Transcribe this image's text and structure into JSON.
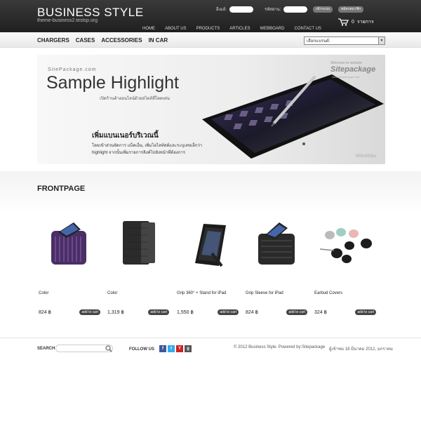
{
  "header": {
    "logo": "BUSINESS STYLE",
    "logo_sub": "theme-business2.testsp.org",
    "login": {
      "email_label": "อีเมล์:",
      "password_label": "รหัสผ่าน:",
      "login_button": "เข้าระบบ",
      "register_button": "สมัครสมาชิก"
    },
    "nav": [
      "HOME",
      "ABOUT US",
      "PRODUCTS",
      "ARTICLES",
      "WEBBOARD",
      "CONTACT US"
    ],
    "cart": {
      "count": "0",
      "label": "รายการ"
    }
  },
  "categories": [
    "CHARGERS",
    "CASES",
    "ACCESSORIES",
    "IN CAR"
  ],
  "brand_select": {
    "value": "เลือกแบรนด์:"
  },
  "banner": {
    "site": "SitePackage.com",
    "title": "Sample Highlight",
    "subtitle": "เปิดร้านค้าออนไลน์ด้วยสไตล์ที่โดดเด่น",
    "welcome": "Welcome to website",
    "brand": "Sitepackage",
    "brand_sub": "www.sitepackage.com",
    "headline": "เพิ่มแบนเนอร์บริเวณนี้",
    "desc1": "โดยเข้าส่วนจัดการ แบ็คเอ็น, เพิ่มไฮไลท์สต์และระบุเลขเล็กว่า",
    "desc2": "highlight จากนั้นเพิ่มรายการลิงค์ไปยังหน้าที่ต้องการ",
    "size": "950x300px"
  },
  "section_title": "FRONTPAGE",
  "products": [
    {
      "name": "Color",
      "price": "824 ฿",
      "button": "add to cart",
      "icon": "purple-sleeve"
    },
    {
      "name": "Color",
      "price": "1,319 ฿",
      "button": "add to cart",
      "icon": "black-folio"
    },
    {
      "name": "Grip 360° + Stand for iPad",
      "price": "1,550 ฿",
      "button": "add to cart",
      "icon": "ipad-stand"
    },
    {
      "name": "Grip Sleeve for iPad",
      "price": "824 ฿",
      "button": "add to cart",
      "icon": "black-sleeve"
    },
    {
      "name": "Earbud Covers",
      "price": "324 ฿",
      "button": "add to cart",
      "icon": "earbuds"
    }
  ],
  "footer": {
    "search_label": "SEARCH",
    "follow_label": "FOLLOW US",
    "social": [
      {
        "letter": "f",
        "color": "#3b5998",
        "icon": "facebook-icon"
      },
      {
        "letter": "t",
        "color": "#33aaee",
        "icon": "twitter-icon"
      },
      {
        "letter": "Y",
        "color": "#cc2222",
        "icon": "youtube-icon"
      },
      {
        "letter": "g",
        "color": "#555555",
        "icon": "google-icon"
      }
    ],
    "copyright": "© 2012 Business Style. Powered by:Sitepackage",
    "date": "ผู้เข้าชม 18 มีนาคม 2012, มกราคม"
  }
}
